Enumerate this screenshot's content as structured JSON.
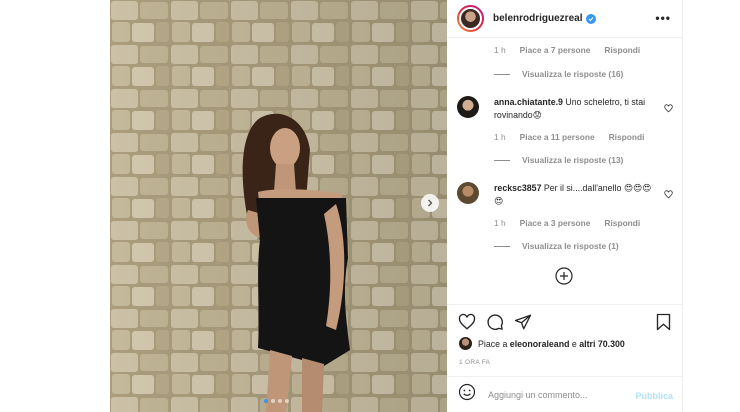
{
  "post": {
    "username": "belenrodriguezreal",
    "verified": true,
    "more_label": "•••",
    "carousel_dots": 4,
    "carousel_active_index": 0
  },
  "threads": [
    {
      "time": "1 h",
      "likes": "Piace a 7 persone",
      "reply": "Rispondi",
      "view_replies": "Visualizza le risposte (16)"
    }
  ],
  "comments": [
    {
      "username": "anna.chiatante.9",
      "text": " Uno scheletro, ti stai rovinando😟",
      "time": "1 h",
      "likes": "Piace a 11 persone",
      "reply": "Rispondi",
      "view_replies": "Visualizza le risposte (13)"
    },
    {
      "username": "recksc3857",
      "text": " Per il si....dall'anello 😍😍😍😍",
      "time": "1 h",
      "likes": "Piace a 3 persone",
      "reply": "Rispondi",
      "view_replies": "Visualizza le risposte (1)"
    }
  ],
  "likes_line": {
    "prefix": "Piace a ",
    "user": "eleonoraleand",
    "connector": " e ",
    "others": "altri 70.300"
  },
  "posted_time": "1 ORA FA",
  "comment_box": {
    "placeholder": "Aggiungi un commento...",
    "publish_label": "Pubblica"
  },
  "colors": {
    "accent": "#3897f0",
    "muted_text": "#8e8e8e",
    "publish_disabled": "#b2dffc"
  },
  "icons": [
    "verified-badge-icon",
    "more-options-icon",
    "heart-icon",
    "comment-icon",
    "share-icon",
    "bookmark-icon",
    "add-circle-icon",
    "emoji-icon",
    "chevron-right-icon"
  ]
}
